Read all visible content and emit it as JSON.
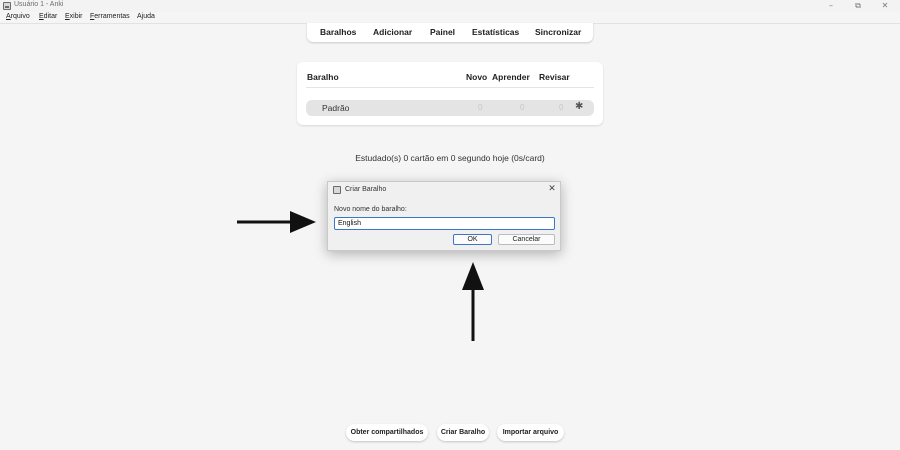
{
  "window": {
    "title": "Usuário 1 - Anki",
    "minimize_glyph": "–",
    "maximize_glyph": "⧉",
    "close_glyph": "✕"
  },
  "menu": {
    "items": [
      {
        "underline": "A",
        "rest": "rquivo"
      },
      {
        "underline": "E",
        "rest": "ditar"
      },
      {
        "underline": "E",
        "rest": "xibir"
      },
      {
        "underline": "F",
        "rest": "erramentas"
      },
      {
        "underline": "",
        "rest": "Ajuda"
      }
    ]
  },
  "toolbar": {
    "decks": "Baralhos",
    "add": "Adicionar",
    "panel": "Painel",
    "stats": "Estatísticas",
    "sync": "Sincronizar"
  },
  "deck_table": {
    "headers": {
      "deck": "Baralho",
      "new": "Novo",
      "learn": "Aprender",
      "review": "Revisar"
    },
    "rows": [
      {
        "name": "Padrão",
        "new": "0",
        "learn": "0",
        "review": "0"
      }
    ],
    "gear_glyph": "✱"
  },
  "studied_text": "Estudado(s) 0 cartão em 0 segundo hoje (0s/card)",
  "dialog": {
    "title": "Criar Baralho",
    "close_glyph": "✕",
    "label": "Novo nome do baralho:",
    "input_value": "English",
    "ok_label": "OK",
    "cancel_label": "Cancelar"
  },
  "bottom_buttons": {
    "shared": "Obter compartilhados",
    "create": "Criar Baralho",
    "import": "Importar arquivo"
  },
  "colors": {
    "background": "#f5f5f5",
    "accent": "#3c76c9",
    "arrow": "#111111"
  }
}
